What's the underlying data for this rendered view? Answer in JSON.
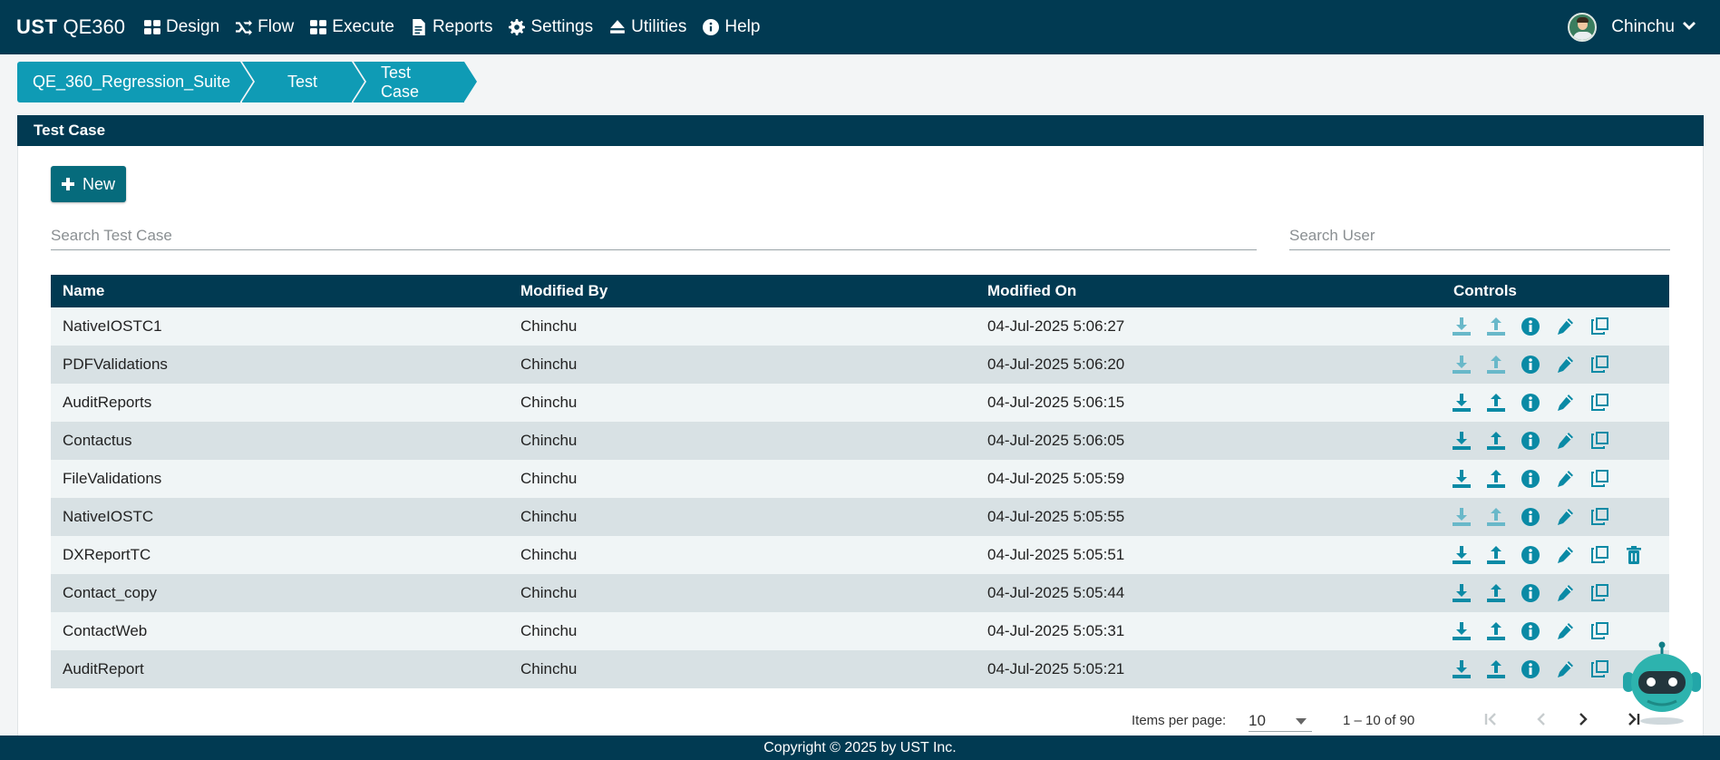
{
  "brand": {
    "primary": "UST",
    "secondary": "QE360"
  },
  "nav": [
    {
      "label": "Design",
      "icon": "grid-icon"
    },
    {
      "label": "Flow",
      "icon": "shuffle-icon"
    },
    {
      "label": "Execute",
      "icon": "grid-icon"
    },
    {
      "label": "Reports",
      "icon": "document-icon"
    },
    {
      "label": "Settings",
      "icon": "gear-icon"
    },
    {
      "label": "Utilities",
      "icon": "eject-icon"
    },
    {
      "label": "Help",
      "icon": "info-icon"
    }
  ],
  "user": {
    "name": "Chinchu"
  },
  "breadcrumb": [
    "QE_360_Regression_Suite",
    "Test",
    "Test Case"
  ],
  "panel": {
    "title": "Test Case",
    "new_label": "New"
  },
  "search": {
    "test_case_placeholder": "Search Test Case",
    "user_placeholder": "Search User"
  },
  "table": {
    "headers": {
      "name": "Name",
      "modified_by": "Modified By",
      "modified_on": "Modified On",
      "controls": "Controls"
    },
    "rows": [
      {
        "name": "NativeIOSTC1",
        "modified_by": "Chinchu",
        "modified_on": "04-Jul-2025 5:06:27"
      },
      {
        "name": "PDFValidations",
        "modified_by": "Chinchu",
        "modified_on": "04-Jul-2025 5:06:20"
      },
      {
        "name": "AuditReports",
        "modified_by": "Chinchu",
        "modified_on": "04-Jul-2025 5:06:15"
      },
      {
        "name": "Contactus",
        "modified_by": "Chinchu",
        "modified_on": "04-Jul-2025 5:06:05"
      },
      {
        "name": "FileValidations",
        "modified_by": "Chinchu",
        "modified_on": "04-Jul-2025 5:05:59"
      },
      {
        "name": "NativeIOSTC",
        "modified_by": "Chinchu",
        "modified_on": "04-Jul-2025 5:05:55"
      },
      {
        "name": "DXReportTC",
        "modified_by": "Chinchu",
        "modified_on": "04-Jul-2025 5:05:51"
      },
      {
        "name": "Contact_copy",
        "modified_by": "Chinchu",
        "modified_on": "04-Jul-2025 5:05:44"
      },
      {
        "name": "ContactWeb",
        "modified_by": "Chinchu",
        "modified_on": "04-Jul-2025 5:05:31"
      },
      {
        "name": "AuditReport",
        "modified_by": "Chinchu",
        "modified_on": "04-Jul-2025 5:05:21"
      }
    ]
  },
  "pager": {
    "items_label": "Items per page:",
    "page_size": "10",
    "range": "1 – 10 of 90"
  },
  "footer": {
    "text": "Copyright © 2025 by UST Inc."
  },
  "colors": {
    "navy": "#013a52",
    "teal": "#0f9bb5",
    "icon": "#0a8aa5",
    "button": "#066b7c"
  }
}
